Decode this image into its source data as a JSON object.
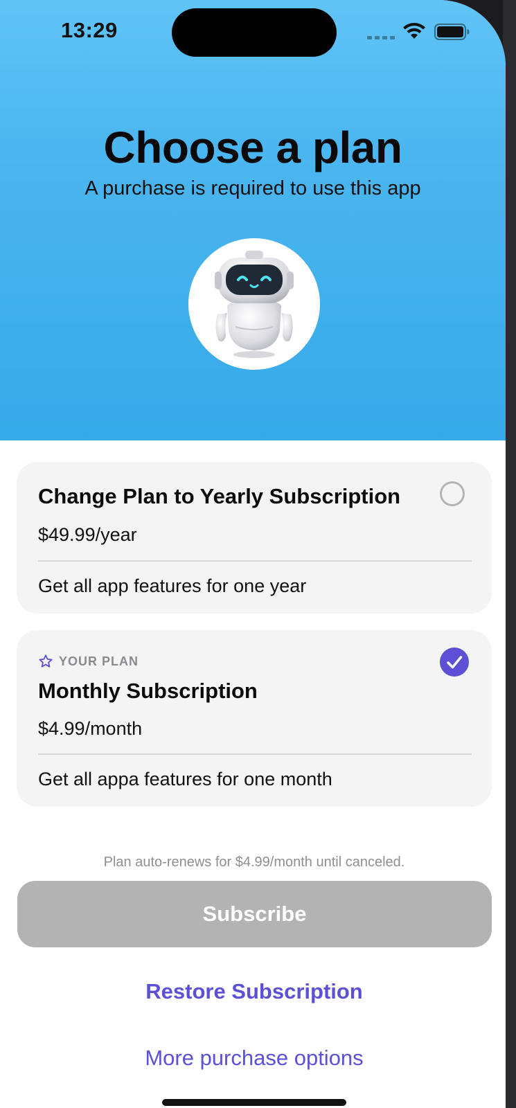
{
  "status_bar": {
    "time": "13:29"
  },
  "header": {
    "title": "Choose a plan",
    "subtitle": "A purchase is required to use this app",
    "avatar_icon": "robot-icon"
  },
  "plans": [
    {
      "title": "Change Plan to Yearly Subscription",
      "price": "$49.99/year",
      "description": "Get all app features for one year",
      "selected": false
    },
    {
      "badge": "YOUR PLAN",
      "badge_icon": "star-icon",
      "title": "Monthly Subscription",
      "price": "$4.99/month",
      "description": "Get all appa features for one month",
      "selected": true
    }
  ],
  "footer": {
    "renew_note": "Plan auto-renews for $4.99/month until canceled.",
    "subscribe_label": "Subscribe",
    "restore_label": "Restore Subscription",
    "more_label": "More purchase options"
  },
  "colors": {
    "accent": "#5b50d6",
    "hero_top": "#61c4f7",
    "hero_bottom": "#36a9e8",
    "button_disabled": "#b3b3b3"
  }
}
